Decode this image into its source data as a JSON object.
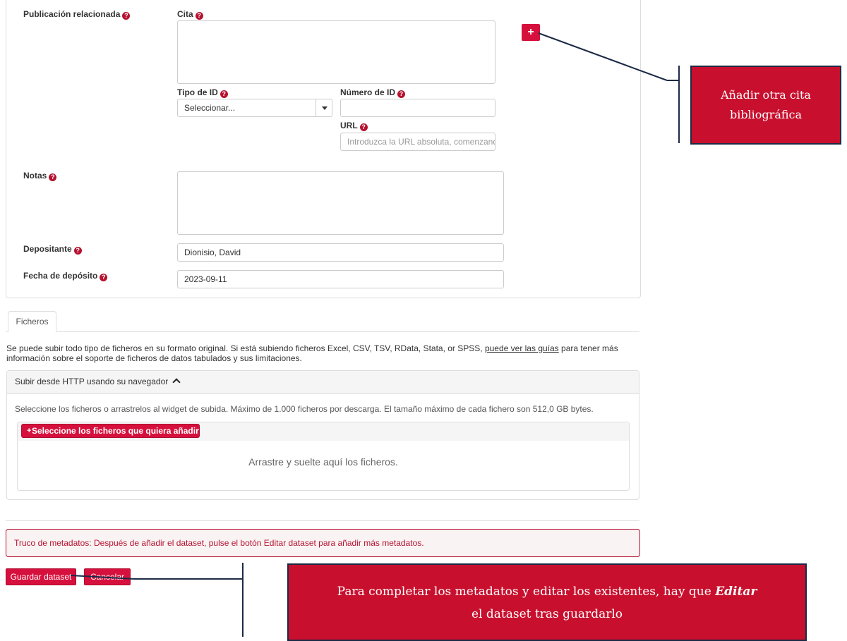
{
  "form": {
    "related_publication_label": "Publicación relacionada",
    "citation_label": "Cita",
    "citation_value": "",
    "id_type_label": "Tipo de ID",
    "id_type_selected": "Seleccionar...",
    "id_number_label": "Número de ID",
    "id_number_value": "",
    "url_label": "URL",
    "url_placeholder": "Introduzca la URL absoluta, comenzando",
    "notes_label": "Notas",
    "notes_value": "",
    "depositor_label": "Depositante",
    "depositor_value": "Dionisio, David",
    "deposit_date_label": "Fecha de depósito",
    "deposit_date_value": "2023-09-11",
    "help_glyph": "?"
  },
  "files": {
    "tab_label": "Ficheros",
    "info_before_link": "Se puede subir todo tipo de ficheros en su formato original. Si está subiendo ficheros Excel, CSV, TSV, RData, Stata, or SPSS, ",
    "info_link": "puede ver las guías",
    "info_after_link": " para tener más información sobre el soporte de ficheros de datos tabulados y sus limitaciones.",
    "upload_header": "Subir desde HTTP usando su navegador",
    "upload_instructions": "Seleccione los ficheros o arrastrelos al widget de subida. Máximo de 1.000 ficheros por descarga. El tamaño máximo de cada fichero son 512,0 GB bytes.",
    "select_button": "Seleccione los ficheros que quiera añadir",
    "drop_text": "Arrastre y suelte aquí los ficheros."
  },
  "alert_text": "Truco de metadatos: Después de añadir el dataset, pulse el botón Editar dataset para añadir más metadatos.",
  "actions": {
    "save_label": "Guardar dataset",
    "cancel_label": "Cancelar",
    "add_citation_glyph": "+"
  },
  "callouts": {
    "add_citation": "Añadir otra cita bibliográfica",
    "edit_note_before": "Para completar los metadatos y editar los existentes, hay que ",
    "edit_note_emphasis": "Editar",
    "edit_note_after": " el dataset  tras guardarlo"
  },
  "colors": {
    "accent": "#d6103d",
    "callout_bg": "#c8102e",
    "callout_line": "#1c2a46"
  }
}
